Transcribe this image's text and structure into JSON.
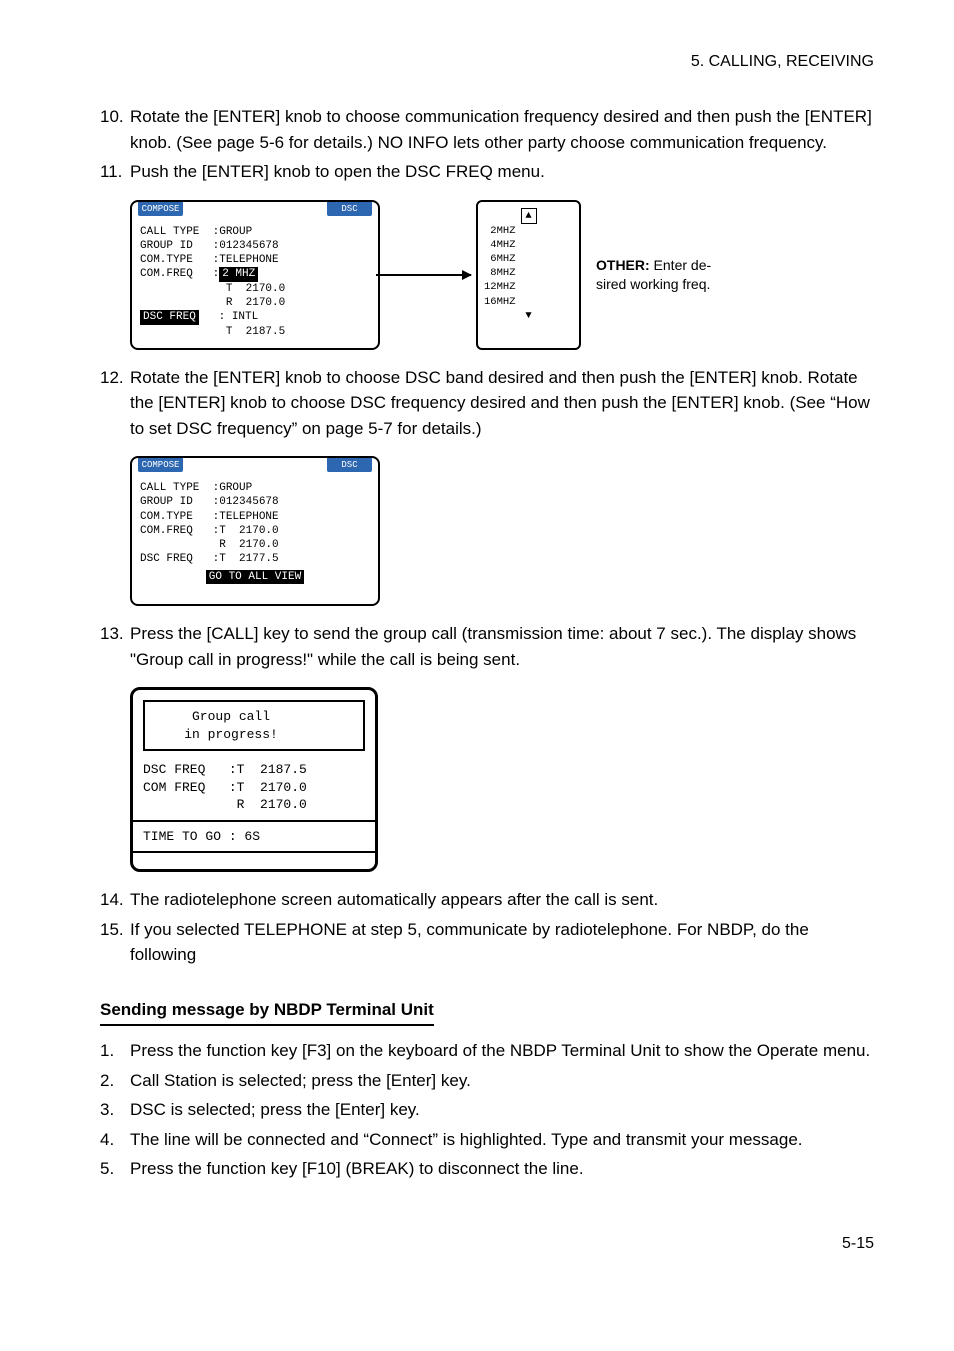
{
  "header": "5.  CALLING,  RECEIVING",
  "steps": {
    "s10": {
      "num": "10.",
      "text": "Rotate the [ENTER] knob to choose communication frequency desired and then push the [ENTER] knob. (See page 5-6 for details.) NO INFO lets other party choose communication frequency."
    },
    "s11": {
      "num": "11.",
      "text": "Push the [ENTER] knob to open the DSC FREQ menu."
    },
    "s12": {
      "num": "12.",
      "text": "Rotate the [ENTER] knob to choose DSC band desired and then push the [ENTER] knob. Rotate the [ENTER] knob to choose DSC frequency desired and then push the [ENTER] knob. (See “How to set DSC frequency” on page 5-7 for details.)"
    },
    "s13": {
      "num": "13.",
      "text": "Press the [CALL] key to send the group call (transmission time: about 7 sec.). The display shows \"Group call in progress!\" while the call is being sent."
    },
    "s14": {
      "num": "14.",
      "text": "The radiotelephone screen automatically appears after the call is sent."
    },
    "s15": {
      "num": "15.",
      "text": "If you selected TELEPHONE at step 5, communicate by radiotelephone. For NBDP, do the following"
    }
  },
  "diagram1": {
    "left": {
      "tabL": "COMPOSE",
      "tabR": "DSC",
      "l1": "CALL TYPE  :GROUP",
      "l2": "GROUP ID   :012345678",
      "l3": "COM.TYPE   :TELEPHONE",
      "l4a": "COM.FREQ   :",
      "l4b": "2 MHZ",
      "l5": "             T  2170.0",
      "l6": "             R  2170.0",
      "bottomA": "DSC FREQ",
      "bottomB": "   : INTL",
      "l8": "             T  2187.5"
    },
    "right": {
      "arrow": "▲",
      "l1": " 2MHZ",
      "l2": " 4MHZ",
      "l3": " 6MHZ",
      "l4": " 8MHZ",
      "l5": "12MHZ",
      "l6": "16MHZ",
      "arrowDn": "▼"
    },
    "otherLabel": {
      "bold": "OTHER:",
      "rest": " Enter de-\nsired working freq."
    }
  },
  "diagram2": {
    "tabL": "COMPOSE",
    "tabR": "DSC",
    "l1": "CALL TYPE  :GROUP",
    "l2": "GROUP ID   :012345678",
    "l3": "COM.TYPE   :TELEPHONE",
    "l4": "COM.FREQ   :T  2170.0",
    "l5": "            R  2170.0",
    "l6": "DSC FREQ   :T  2177.5",
    "bottomInv": "GO TO ALL VIEW"
  },
  "diagram3": {
    "inner1": "     Group call",
    "inner2": "    in progress!",
    "mid1": "DSC FREQ   :T  2187.5",
    "mid2": "COM FREQ   :T  2170.0",
    "mid3": "            R  2170.0",
    "bottom": "TIME TO GO : 6S"
  },
  "sectionHeading": "Sending message by NBDP Terminal Unit",
  "nbdp": {
    "n1": {
      "num": "1.",
      "text": "Press the function key [F3] on the keyboard of the NBDP Terminal Unit to show the Operate menu."
    },
    "n2": {
      "num": "2.",
      "text": "Call Station is selected; press the [Enter] key."
    },
    "n3": {
      "num": "3.",
      "text": "DSC is selected; press the [Enter] key."
    },
    "n4": {
      "num": "4.",
      "text": "The line will be connected and “Connect” is highlighted. Type and transmit your message."
    },
    "n5": {
      "num": "5.",
      "text": "Press the function key [F10] (BREAK) to disconnect the line."
    }
  },
  "footer": "5-15"
}
